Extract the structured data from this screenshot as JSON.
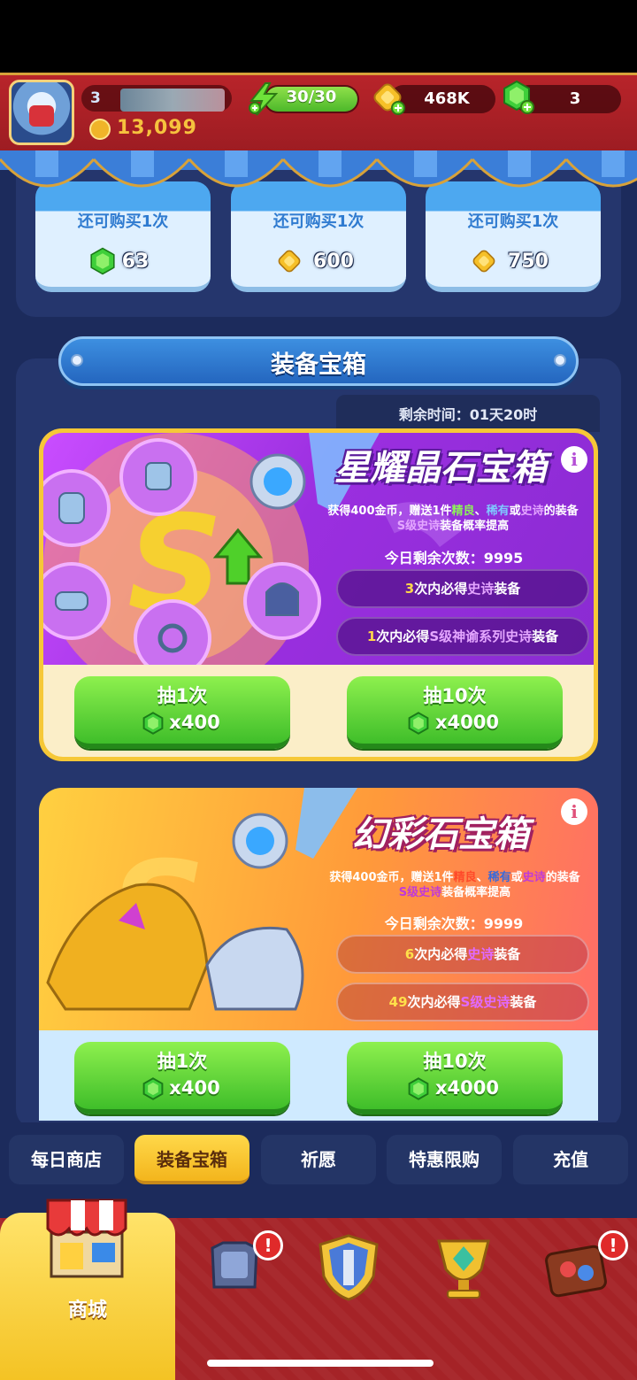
{
  "header": {
    "level": "3",
    "rank_value": "13,099",
    "energy": "30/30",
    "gold": "468K",
    "gems": "3"
  },
  "daily_items": [
    {
      "limit_label": "还可购买1次",
      "price": "63",
      "currency": "gem"
    },
    {
      "limit_label": "还可购买1次",
      "price": "600",
      "currency": "gold"
    },
    {
      "limit_label": "还可购买1次",
      "price": "750",
      "currency": "gold"
    }
  ],
  "section": {
    "title": "装备宝箱",
    "timer": "剩余时间：01天20时"
  },
  "chest1": {
    "title": "星耀晶石宝箱",
    "desc_pre": "获得400金币，赠送1件",
    "desc_q1": "精良",
    "desc_sep": "、",
    "desc_q2": "稀有",
    "desc_or": "或",
    "desc_q3": "史诗",
    "desc_post": "的装备",
    "desc_line2_hl": "S级史诗",
    "desc_line2": "装备概率提高",
    "remaining": "今日剩余次数：9995",
    "guarantee1_num": "3",
    "guarantee1_pre": "次内必得",
    "guarantee1_hl": "史诗",
    "guarantee1_post": "装备",
    "guarantee2_num": "1",
    "guarantee2_pre": "次内必得",
    "guarantee2_hl": "S级神谕系列史诗",
    "guarantee2_post": "装备",
    "draw1_label": "抽1次",
    "draw1_cost": "x400",
    "draw10_label": "抽10次",
    "draw10_cost": "x4000"
  },
  "chest2": {
    "title": "幻彩石宝箱",
    "desc_pre": "获得400金币，赠送1件",
    "desc_q1": "精良",
    "desc_sep": "、",
    "desc_q2": "稀有",
    "desc_or": "或",
    "desc_q3": "史诗",
    "desc_post": "的装备",
    "desc_line2_hl": "S级史诗",
    "desc_line2": "装备概率提高",
    "remaining": "今日剩余次数：9999",
    "guarantee1_num": "6",
    "guarantee1_pre": "次内必得",
    "guarantee1_hl": "史诗",
    "guarantee1_post": "装备",
    "guarantee2_num": "49",
    "guarantee2_pre": "次内必得",
    "guarantee2_hl": "S级史诗",
    "guarantee2_post": "装备",
    "draw1_label": "抽1次",
    "draw1_cost": "x400",
    "draw10_label": "抽10次",
    "draw10_cost": "x4000"
  },
  "tabs": [
    "每日商店",
    "装备宝箱",
    "祈愿",
    "特惠限购",
    "充值"
  ],
  "active_tab": "装备宝箱",
  "bottom_nav": {
    "active_label": "商城",
    "badge": "!"
  },
  "colors": {
    "header_red": "#b8242a",
    "panel_blue": "#25366d",
    "chest1_purple": "#9b2fe0",
    "button_green": "#3fbe2a",
    "tab_active_yellow": "#f3b51c"
  }
}
